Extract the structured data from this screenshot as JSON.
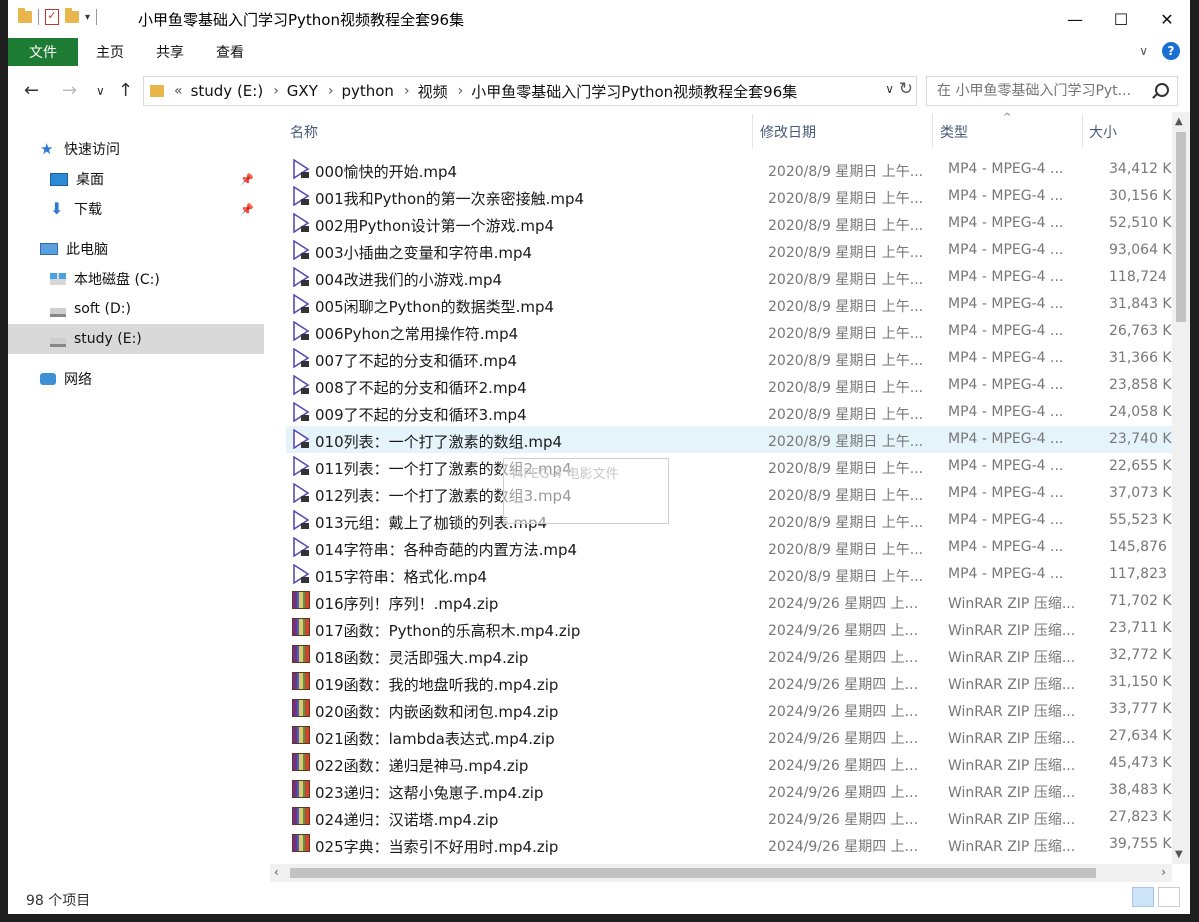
{
  "window": {
    "title": "小甲鱼零基础入门学习Python视频教程全套96集",
    "minimize": "—",
    "maximize": "☐",
    "close": "✕"
  },
  "ribbon": {
    "file_tab": "文件",
    "tabs": [
      "主页",
      "共享",
      "查看"
    ],
    "expand": "∨",
    "help": "?"
  },
  "address": {
    "breadcrumb": [
      "study (E:)",
      "GXY",
      "python",
      "视频",
      "小甲鱼零基础入门学习Python视频教程全套96集"
    ],
    "overflow": "«",
    "search_placeholder": "在 小甲鱼零基础入门学习Pyt..."
  },
  "nav": {
    "back": "←",
    "forward": "→",
    "recent": "∨",
    "up": "↑",
    "items": [
      {
        "label": "快速访问",
        "icon": "star-icon"
      },
      {
        "label": "桌面",
        "icon": "desktop-icon",
        "pinned": true
      },
      {
        "label": "下载",
        "icon": "download-icon",
        "pinned": true
      },
      {
        "label": "此电脑",
        "icon": "computer-icon"
      },
      {
        "label": "本地磁盘 (C:)",
        "icon": "windows-drive-icon"
      },
      {
        "label": "soft (D:)",
        "icon": "drive-icon"
      },
      {
        "label": "study (E:)",
        "icon": "drive-icon",
        "selected": true
      },
      {
        "label": "网络",
        "icon": "network-icon"
      }
    ]
  },
  "columns": {
    "name": "名称",
    "date": "修改日期",
    "type": "类型",
    "size": "大小"
  },
  "files": [
    {
      "name": "000愉快的开始.mp4",
      "date": "2020/8/9 星期日 上午...",
      "type": "MP4 - MPEG-4 ...",
      "size": "34,412 KB",
      "kind": "mp4"
    },
    {
      "name": "001我和Python的第一次亲密接触.mp4",
      "date": "2020/8/9 星期日 上午...",
      "type": "MP4 - MPEG-4 ...",
      "size": "30,156 KB",
      "kind": "mp4"
    },
    {
      "name": "002用Python设计第一个游戏.mp4",
      "date": "2020/8/9 星期日 上午...",
      "type": "MP4 - MPEG-4 ...",
      "size": "52,510 KB",
      "kind": "mp4"
    },
    {
      "name": "003小插曲之变量和字符串.mp4",
      "date": "2020/8/9 星期日 上午...",
      "type": "MP4 - MPEG-4 ...",
      "size": "93,064 KB",
      "kind": "mp4"
    },
    {
      "name": "004改进我们的小游戏.mp4",
      "date": "2020/8/9 星期日 上午...",
      "type": "MP4 - MPEG-4 ...",
      "size": "118,724 KB",
      "kind": "mp4"
    },
    {
      "name": "005闲聊之Python的数据类型.mp4",
      "date": "2020/8/9 星期日 上午...",
      "type": "MP4 - MPEG-4 ...",
      "size": "31,843 KB",
      "kind": "mp4"
    },
    {
      "name": "006Pyhon之常用操作符.mp4",
      "date": "2020/8/9 星期日 上午...",
      "type": "MP4 - MPEG-4 ...",
      "size": "26,763 KB",
      "kind": "mp4"
    },
    {
      "name": "007了不起的分支和循环.mp4",
      "date": "2020/8/9 星期日 上午...",
      "type": "MP4 - MPEG-4 ...",
      "size": "31,366 KB",
      "kind": "mp4"
    },
    {
      "name": "008了不起的分支和循环2.mp4",
      "date": "2020/8/9 星期日 上午...",
      "type": "MP4 - MPEG-4 ...",
      "size": "23,858 KB",
      "kind": "mp4"
    },
    {
      "name": "009了不起的分支和循环3.mp4",
      "date": "2020/8/9 星期日 上午...",
      "type": "MP4 - MPEG-4 ...",
      "size": "24,058 KB",
      "kind": "mp4"
    },
    {
      "name": "010列表：一个打了激素的数组.mp4",
      "date": "2020/8/9 星期日 上午...",
      "type": "MP4 - MPEG-4 ...",
      "size": "23,740 KB",
      "kind": "mp4",
      "hover": true
    },
    {
      "name": "011列表：一个打了激素的数组2.mp4",
      "date": "2020/8/9 星期日 上午...",
      "type": "MP4 - MPEG-4 ...",
      "size": "22,655 KB",
      "kind": "mp4"
    },
    {
      "name": "012列表：一个打了激素的数组3.mp4",
      "date": "2020/8/9 星期日 上午...",
      "type": "MP4 - MPEG-4 ...",
      "size": "37,073 KB",
      "kind": "mp4"
    },
    {
      "name": "013元组：戴上了枷锁的列表.mp4",
      "date": "2020/8/9 星期日 上午...",
      "type": "MP4 - MPEG-4 ...",
      "size": "55,523 KB",
      "kind": "mp4"
    },
    {
      "name": "014字符串：各种奇葩的内置方法.mp4",
      "date": "2020/8/9 星期日 上午...",
      "type": "MP4 - MPEG-4 ...",
      "size": "145,876 KB",
      "kind": "mp4"
    },
    {
      "name": "015字符串：格式化.mp4",
      "date": "2020/8/9 星期日 上午...",
      "type": "MP4 - MPEG-4 ...",
      "size": "117,823 KB",
      "kind": "mp4"
    },
    {
      "name": "016序列！序列！.mp4.zip",
      "date": "2024/9/26 星期四 上...",
      "type": "WinRAR ZIP 压缩...",
      "size": "71,702 KB",
      "kind": "zip"
    },
    {
      "name": "017函数：Python的乐高积木.mp4.zip",
      "date": "2024/9/26 星期四 上...",
      "type": "WinRAR ZIP 压缩...",
      "size": "23,711 KB",
      "kind": "zip"
    },
    {
      "name": "018函数：灵活即强大.mp4.zip",
      "date": "2024/9/26 星期四 上...",
      "type": "WinRAR ZIP 压缩...",
      "size": "32,772 KB",
      "kind": "zip"
    },
    {
      "name": "019函数：我的地盘听我的.mp4.zip",
      "date": "2024/9/26 星期四 上...",
      "type": "WinRAR ZIP 压缩...",
      "size": "31,150 KB",
      "kind": "zip"
    },
    {
      "name": "020函数：内嵌函数和闭包.mp4.zip",
      "date": "2024/9/26 星期四 上...",
      "type": "WinRAR ZIP 压缩...",
      "size": "33,777 KB",
      "kind": "zip"
    },
    {
      "name": "021函数：lambda表达式.mp4.zip",
      "date": "2024/9/26 星期四 上...",
      "type": "WinRAR ZIP 压缩...",
      "size": "27,634 KB",
      "kind": "zip"
    },
    {
      "name": "022函数：递归是神马.mp4.zip",
      "date": "2024/9/26 星期四 上...",
      "type": "WinRAR ZIP 压缩...",
      "size": "45,473 KB",
      "kind": "zip"
    },
    {
      "name": "023递归：这帮小兔崽子.mp4.zip",
      "date": "2024/9/26 星期四 上...",
      "type": "WinRAR ZIP 压缩...",
      "size": "38,483 KB",
      "kind": "zip"
    },
    {
      "name": "024递归：汉诺塔.mp4.zip",
      "date": "2024/9/26 星期四 上...",
      "type": "WinRAR ZIP 压缩...",
      "size": "27,823 KB",
      "kind": "zip"
    },
    {
      "name": "025字典：当索引不好用时.mp4.zip",
      "date": "2024/9/26 星期四 上...",
      "type": "WinRAR ZIP 压缩...",
      "size": "39,755 KB",
      "kind": "zip"
    }
  ],
  "tooltip": {
    "text": "MPEG-4 电影文件"
  },
  "status": {
    "item_count": "98 个项目"
  },
  "colors": {
    "file_tab": "#1e7b34",
    "selected_nav": "#d9d9d9",
    "hover_row": "#e5f3fb",
    "header_text": "#4a5b75"
  }
}
